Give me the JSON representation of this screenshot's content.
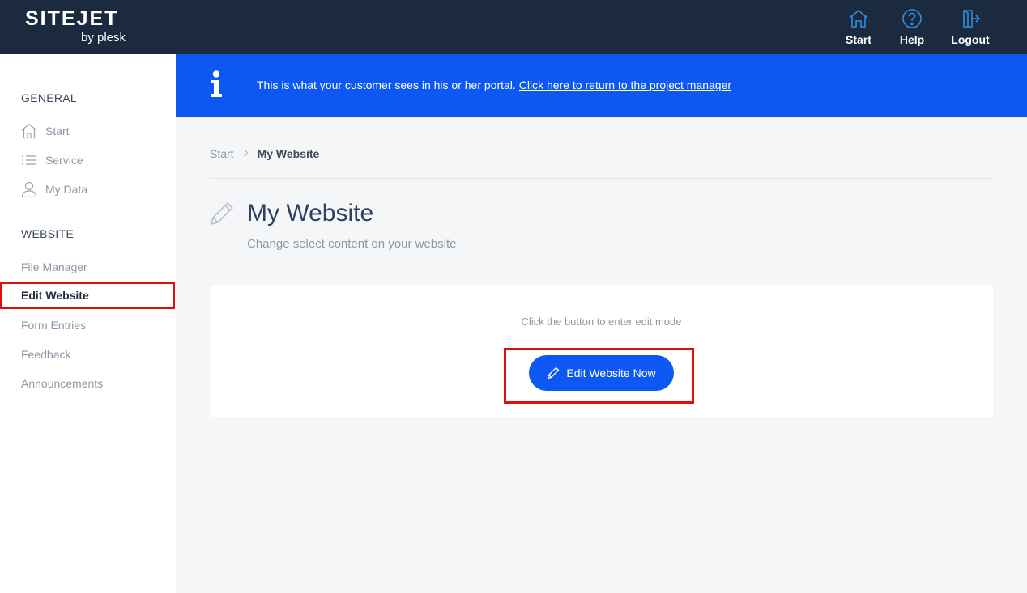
{
  "header": {
    "logo_main": "SITEJET",
    "logo_sub": "by plesk",
    "nav": [
      {
        "label": "Start",
        "icon": "home-icon"
      },
      {
        "label": "Help",
        "icon": "help-icon"
      },
      {
        "label": "Logout",
        "icon": "logout-icon"
      }
    ]
  },
  "sidebar": {
    "general_heading": "GENERAL",
    "general_items": [
      {
        "label": "Start",
        "icon": "home-icon"
      },
      {
        "label": "Service",
        "icon": "list-icon"
      },
      {
        "label": "My Data",
        "icon": "user-icon"
      }
    ],
    "website_heading": "WEBSITE",
    "website_items": [
      {
        "label": "File Manager"
      },
      {
        "label": "Edit Website",
        "active": true
      },
      {
        "label": "Form Entries"
      },
      {
        "label": "Feedback"
      },
      {
        "label": "Announcements"
      }
    ]
  },
  "banner": {
    "text": "This is what your customer sees in his or her portal.",
    "link": "Click here to return to the project manager"
  },
  "breadcrumb": {
    "start": "Start",
    "current": "My Website"
  },
  "page": {
    "title": "My Website",
    "subtitle": "Change select content on your website"
  },
  "card": {
    "hint": "Click the button to enter edit mode",
    "button_label": "Edit Website Now"
  },
  "colors": {
    "topbar": "#1c2a40",
    "accent": "#0d57f2",
    "highlight": "#e00d0d"
  }
}
